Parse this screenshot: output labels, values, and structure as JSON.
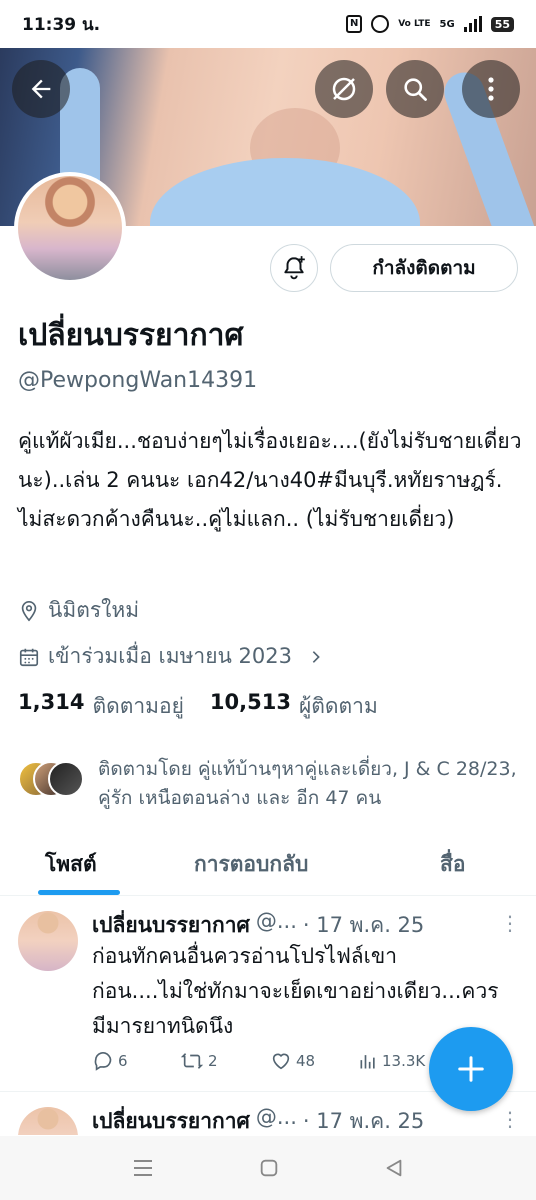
{
  "status_bar": {
    "time": "11:39 น.",
    "battery": "55",
    "network": "5G",
    "volte": "Vo LTE"
  },
  "profile": {
    "display_name": "เปลี่ยนบรรยากาศ",
    "handle": "@PewpongWan14391",
    "bio": "คู่แท้ผัวเมีย...ชอบง่ายๆไม่เรื่องเยอะ....(ยังไม่รับชายเดี่ยวนะ)..เล่น 2 คนนะ เอก42/นาง40#มีนบุรี.หทัยราษฎร์. ไม่สะดวกค้างคืนนะ..คู่ไม่แลก.. (ไม่รับชายเดี่ยว)",
    "location": "นิมิตรใหม่",
    "joined": "เข้าร่วมเมื่อ เมษายน 2023",
    "following_count": "1,314",
    "following_label": "ติดตามอยู่",
    "followers_count": "10,513",
    "followers_label": "ผู้ติดตาม",
    "followed_by": "ติดตามโดย คู่แท้บ้านๆหาคู่และเดี่ยว, J & C 28/23, คู่รัก เหนือตอนล่าง และ อีก 47 คน",
    "follow_button": "กำลังติดตาม"
  },
  "tabs": [
    {
      "label": "โพสต์",
      "active": true
    },
    {
      "label": "การตอบกลับ",
      "active": false
    },
    {
      "label": "สื่อ",
      "active": false
    }
  ],
  "posts": [
    {
      "name": "เปลี่ยนบรรยากาศ",
      "handle": "@...",
      "date": "· 17 พ.ค. 25",
      "text": "ก่อนทักคนอื่นควรอ่านโปรไฟล์เขาก่อน....ไม่ใช่ทักมาจะเย็ดเขาอย่างเดียว...ควรมีมารยาทนิดนึง",
      "replies": "6",
      "reposts": "2",
      "likes": "48",
      "views": "13.3K"
    },
    {
      "name": "เปลี่ยนบรรยากาศ",
      "handle": "@...",
      "date": "· 17 พ.ค. 25"
    }
  ],
  "colors": {
    "accent": "#1d9bf0",
    "text": "#0f1419",
    "muted": "#536471"
  }
}
